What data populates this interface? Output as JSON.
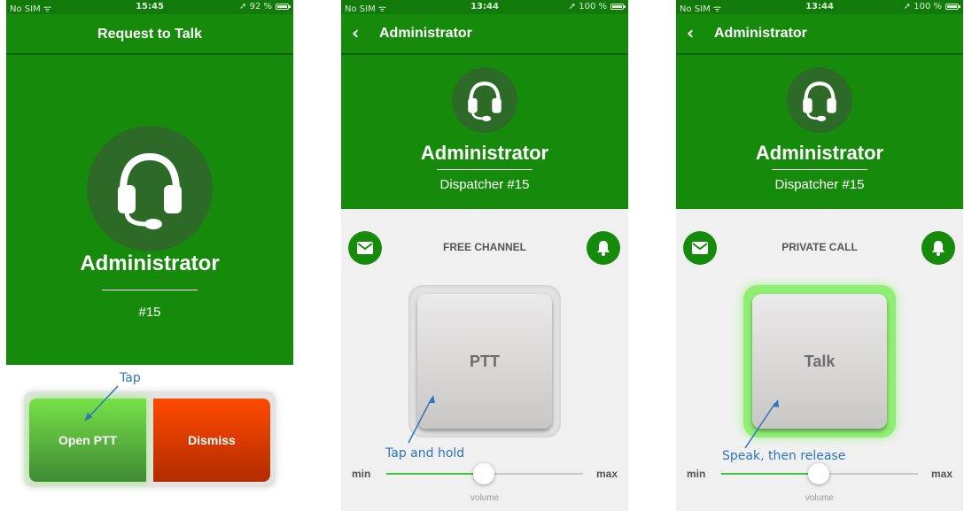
{
  "colors": {
    "brand_green": "#168a0b",
    "accent_light_green": "#3ec53a",
    "dismiss_red": "#ff4a00",
    "annotation_blue": "#2e74c0"
  },
  "screen1": {
    "status": {
      "carrier": "No SIM",
      "time": "15:45",
      "battery": "92 %",
      "battery_level": 0.92
    },
    "title": "Request to Talk",
    "avatar_icon": "headset-icon",
    "name": "Administrator",
    "id": "#15",
    "buttons": {
      "open_ptt": "Open PTT",
      "dismiss": "Dismiss"
    },
    "annotation": "Tap"
  },
  "screen2": {
    "status": {
      "carrier": "No SIM",
      "time": "13:44",
      "battery": "100 %",
      "battery_level": 1.0
    },
    "back_icon": "chevron-left-icon",
    "nav_title": "Administrator",
    "avatar_icon": "headset-icon",
    "name": "Administrator",
    "subtitle": "Dispatcher #15",
    "channel": "FREE CHANNEL",
    "left_icon": "mail-icon",
    "right_icon": "bell-icon",
    "button_label": "PTT",
    "annotation": "Tap and hold",
    "slider": {
      "min_label": "min",
      "max_label": "max",
      "caption": "volume",
      "value": 0.5
    }
  },
  "screen3": {
    "status": {
      "carrier": "No SIM",
      "time": "13:44",
      "battery": "100 %",
      "battery_level": 1.0
    },
    "back_icon": "chevron-left-icon",
    "nav_title": "Administrator",
    "avatar_icon": "headset-icon",
    "name": "Administrator",
    "subtitle": "Dispatcher #15",
    "channel": "PRIVATE CALL",
    "left_icon": "mail-icon",
    "right_icon": "bell-icon",
    "button_label": "Talk",
    "annotation": "Speak, then release",
    "slider": {
      "min_label": "min",
      "max_label": "max",
      "caption": "volume",
      "value": 0.5
    }
  }
}
